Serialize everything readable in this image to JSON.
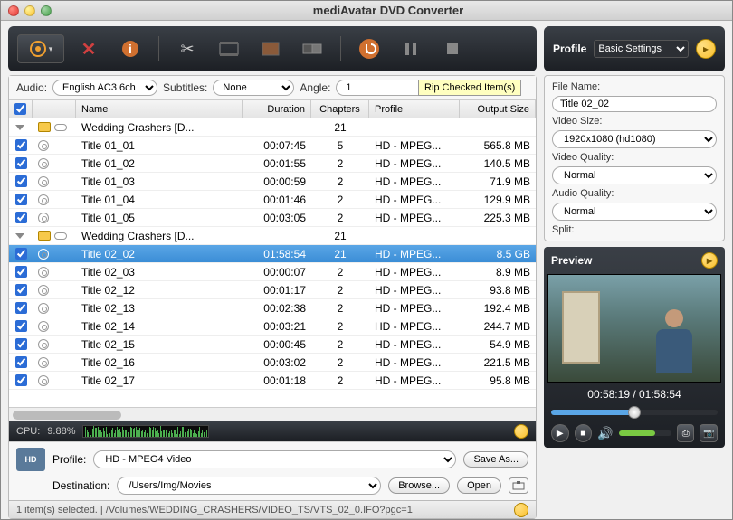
{
  "title": "mediAvatar DVD Converter",
  "tooltip": "Rip Checked Item(s)",
  "profile_panel_label": "Profile",
  "basic_settings_label": "Basic Settings",
  "audio": {
    "label": "Audio:",
    "value": "English AC3 6ch",
    "subtitles_label": "Subtitles:",
    "subtitles_value": "None",
    "angle_label": "Angle:",
    "angle_value": "1"
  },
  "columns": {
    "name": "Name",
    "duration": "Duration",
    "chapters": "Chapters",
    "profile": "Profile",
    "output_size": "Output Size"
  },
  "rows": [
    {
      "type": "group",
      "expanded": true,
      "checked": false,
      "name": "Wedding Crashers [D...",
      "duration": "",
      "chapters": "21",
      "profile": "",
      "size": ""
    },
    {
      "type": "item",
      "checked": true,
      "name": "Title 01_01",
      "duration": "00:07:45",
      "chapters": "5",
      "profile": "HD - MPEG...",
      "size": "565.8 MB"
    },
    {
      "type": "item",
      "checked": true,
      "name": "Title 01_02",
      "duration": "00:01:55",
      "chapters": "2",
      "profile": "HD - MPEG...",
      "size": "140.5 MB"
    },
    {
      "type": "item",
      "checked": true,
      "name": "Title 01_03",
      "duration": "00:00:59",
      "chapters": "2",
      "profile": "HD - MPEG...",
      "size": "71.9 MB"
    },
    {
      "type": "item",
      "checked": true,
      "name": "Title 01_04",
      "duration": "00:01:46",
      "chapters": "2",
      "profile": "HD - MPEG...",
      "size": "129.9 MB"
    },
    {
      "type": "item",
      "checked": true,
      "name": "Title 01_05",
      "duration": "00:03:05",
      "chapters": "2",
      "profile": "HD - MPEG...",
      "size": "225.3 MB"
    },
    {
      "type": "group",
      "expanded": true,
      "checked": false,
      "name": "Wedding Crashers [D...",
      "duration": "",
      "chapters": "21",
      "profile": "",
      "size": ""
    },
    {
      "type": "item",
      "checked": true,
      "selected": true,
      "name": "Title 02_02",
      "duration": "01:58:54",
      "chapters": "21",
      "profile": "HD - MPEG...",
      "size": "8.5 GB"
    },
    {
      "type": "item",
      "checked": true,
      "name": "Title 02_03",
      "duration": "00:00:07",
      "chapters": "2",
      "profile": "HD - MPEG...",
      "size": "8.9 MB"
    },
    {
      "type": "item",
      "checked": true,
      "name": "Title 02_12",
      "duration": "00:01:17",
      "chapters": "2",
      "profile": "HD - MPEG...",
      "size": "93.8 MB"
    },
    {
      "type": "item",
      "checked": true,
      "name": "Title 02_13",
      "duration": "00:02:38",
      "chapters": "2",
      "profile": "HD - MPEG...",
      "size": "192.4 MB"
    },
    {
      "type": "item",
      "checked": true,
      "name": "Title 02_14",
      "duration": "00:03:21",
      "chapters": "2",
      "profile": "HD - MPEG...",
      "size": "244.7 MB"
    },
    {
      "type": "item",
      "checked": true,
      "name": "Title 02_15",
      "duration": "00:00:45",
      "chapters": "2",
      "profile": "HD - MPEG...",
      "size": "54.9 MB"
    },
    {
      "type": "item",
      "checked": true,
      "name": "Title 02_16",
      "duration": "00:03:02",
      "chapters": "2",
      "profile": "HD - MPEG...",
      "size": "221.5 MB"
    },
    {
      "type": "item",
      "checked": true,
      "name": "Title 02_17",
      "duration": "00:01:18",
      "chapters": "2",
      "profile": "HD - MPEG...",
      "size": "95.8 MB"
    }
  ],
  "cpu": {
    "label": "CPU:",
    "value": "9.88%"
  },
  "profile": {
    "label": "Profile:",
    "value": "HD - MPEG4 Video",
    "save_as": "Save As..."
  },
  "destination": {
    "label": "Destination:",
    "value": "/Users/Img/Movies",
    "browse": "Browse...",
    "open": "Open"
  },
  "status": "1 item(s) selected. | /Volumes/WEDDING_CRASHERS/VIDEO_TS/VTS_02_0.IFO?pgc=1",
  "settings": {
    "file_name_label": "File Name:",
    "file_name": "Title 02_02",
    "video_size_label": "Video Size:",
    "video_size": "1920x1080 (hd1080)",
    "video_quality_label": "Video Quality:",
    "video_quality": "Normal",
    "audio_quality_label": "Audio Quality:",
    "audio_quality": "Normal",
    "split_label": "Split:"
  },
  "preview": {
    "label": "Preview",
    "time": "00:58:19 / 01:58:54"
  }
}
